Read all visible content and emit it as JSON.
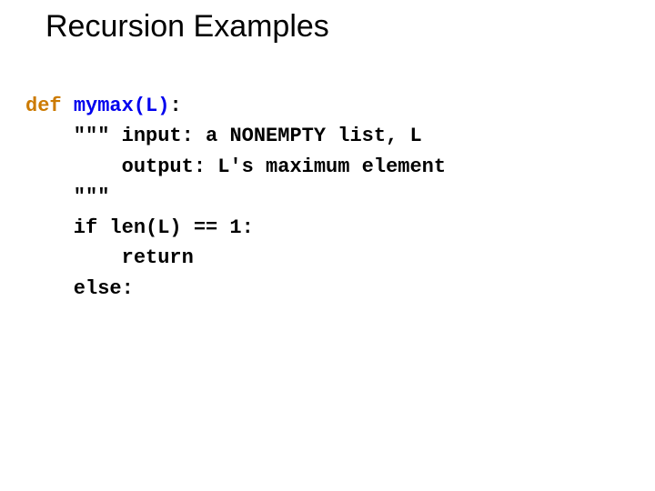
{
  "title": "Recursion Examples",
  "code": {
    "kw_def": "def",
    "fn_name": "mymax(L)",
    "colon": ":",
    "doc_open": "    \"\"\" ",
    "doc_l1_rest": "input: a NONEMPTY list, L",
    "doc_l2": "        output: L's maximum element",
    "doc_close": "    \"\"\"",
    "if_line": "    if len(L) == 1:",
    "return_line": "        return",
    "else_line": "    else:"
  }
}
